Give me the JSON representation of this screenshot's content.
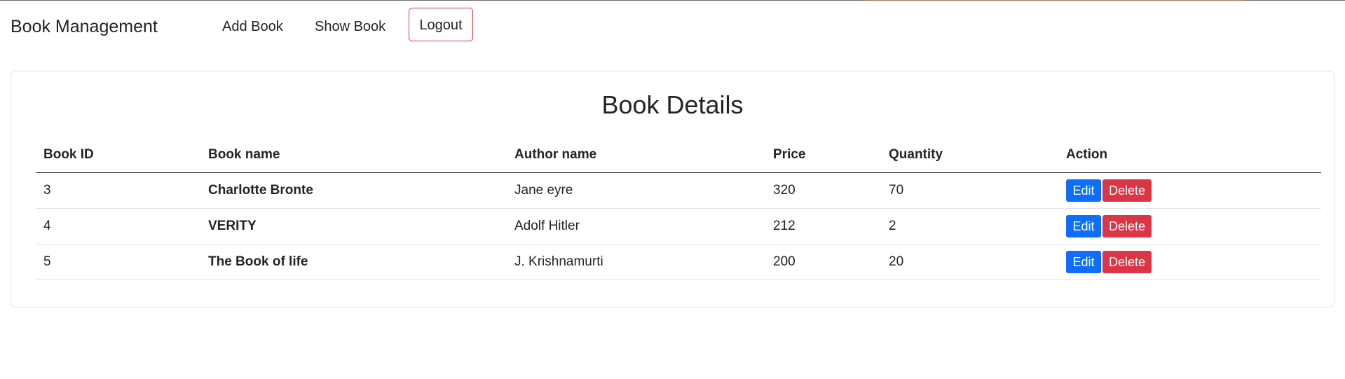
{
  "navbar": {
    "brand": "Book Management",
    "links": [
      "Add Book",
      "Show Book"
    ],
    "logout_label": "Logout"
  },
  "card": {
    "title": "Book Details"
  },
  "table": {
    "headers": [
      "Book ID",
      "Book name",
      "Author name",
      "Price",
      "Quantity",
      "Action"
    ],
    "rows": [
      [
        "3",
        "Charlotte Bronte",
        "Jane eyre",
        "320",
        "70"
      ],
      [
        "4",
        "VERITY",
        "Adolf Hitler",
        "212",
        "2"
      ],
      [
        "5",
        "The Book of life",
        "J. Krishnamurti",
        "200",
        "20"
      ]
    ],
    "edit_label": "Edit",
    "delete_label": "Delete"
  },
  "colors": {
    "primary": "#0d6efd",
    "danger": "#dc3545",
    "text": "#212529"
  }
}
